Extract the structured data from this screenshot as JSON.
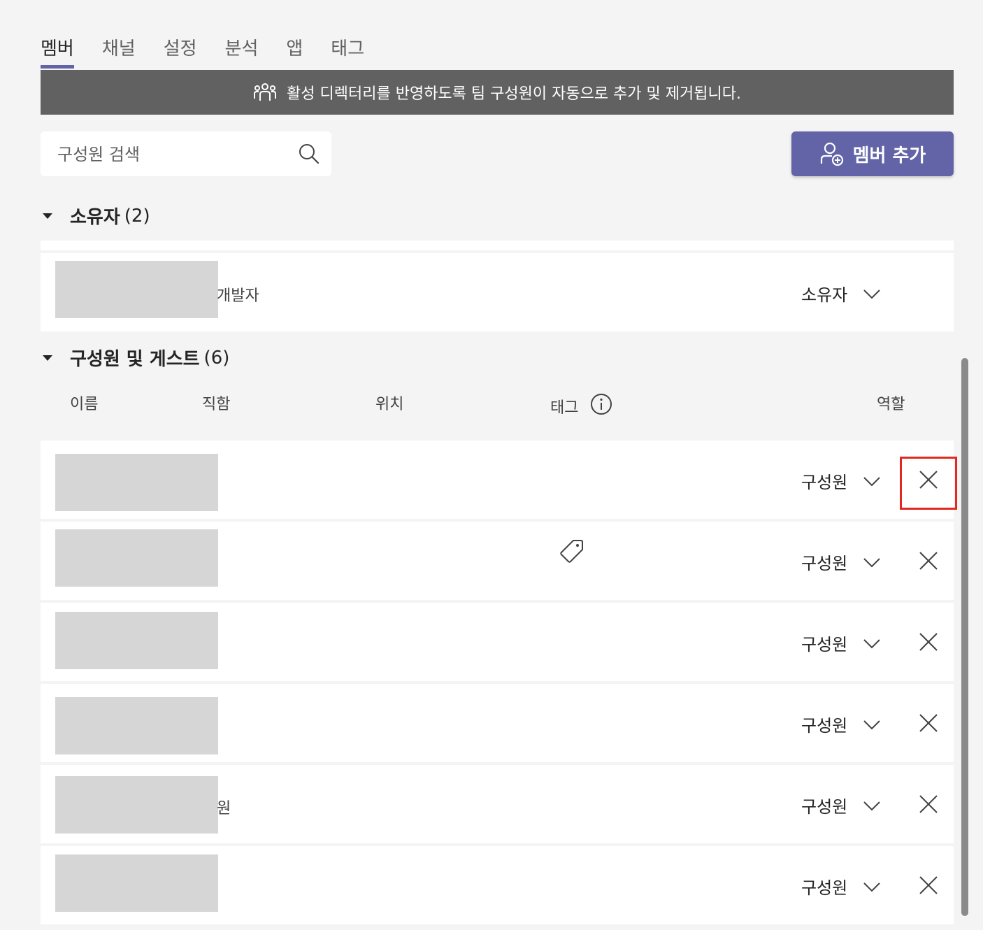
{
  "tabs": [
    {
      "label": "멤버",
      "active": true
    },
    {
      "label": "채널",
      "active": false
    },
    {
      "label": "설정",
      "active": false
    },
    {
      "label": "분석",
      "active": false
    },
    {
      "label": "앱",
      "active": false
    },
    {
      "label": "태그",
      "active": false
    }
  ],
  "banner": {
    "text": "활성 디렉터리를 반영하도록 팀 구성원이 자동으로 추가 및 제거됩니다.",
    "icon": "team-icon"
  },
  "search": {
    "placeholder": "구성원 검색",
    "value": "",
    "icon": "search-icon"
  },
  "add_member_button": {
    "label": "멤버 추가",
    "icon": "person-add-icon"
  },
  "owners": {
    "title": "소유자",
    "count": "(2)",
    "rows": [
      {
        "subtext": "개발자",
        "role": "소유자"
      }
    ]
  },
  "members": {
    "title": "구성원 및 게스트",
    "count": "(6)",
    "columns": {
      "name": "이름",
      "title": "직함",
      "location": "위치",
      "tags": "태그",
      "role": "역할"
    },
    "rows": [
      {
        "subtext": "",
        "role": "구성원",
        "has_tag": false
      },
      {
        "subtext": "",
        "role": "구성원",
        "has_tag": true
      },
      {
        "subtext": "",
        "role": "구성원",
        "has_tag": false
      },
      {
        "subtext": "",
        "role": "구성원",
        "has_tag": false
      },
      {
        "subtext": "원",
        "role": "구성원",
        "has_tag": false
      },
      {
        "subtext": "",
        "role": "구성원",
        "has_tag": false
      }
    ]
  },
  "colors": {
    "accent": "#6264a7",
    "banner_bg": "#616161",
    "highlight": "#e3291f",
    "page_bg": "#f4f4f4"
  }
}
